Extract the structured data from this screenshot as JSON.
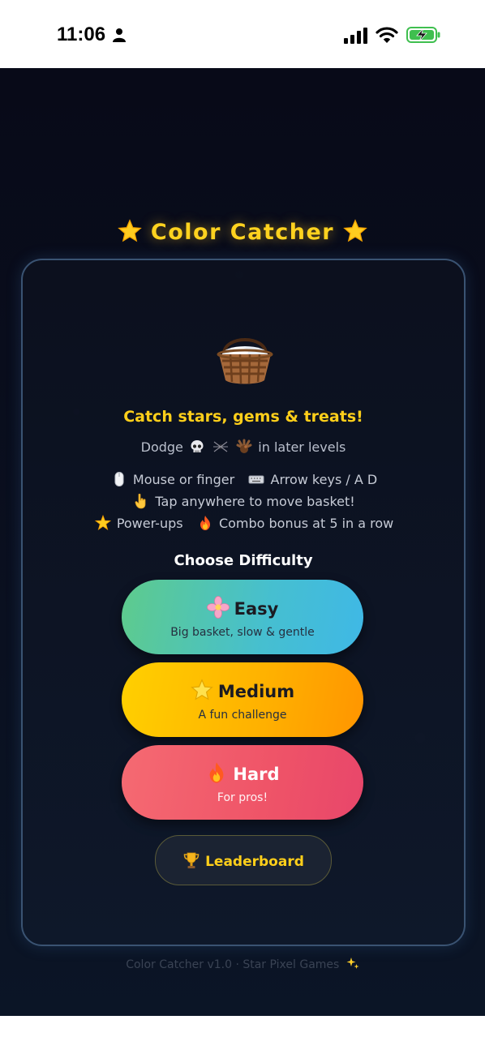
{
  "status_bar": {
    "time": "11:06",
    "icons": [
      "person-icon",
      "signal-icon",
      "wifi-icon",
      "battery-charging-icon"
    ]
  },
  "game": {
    "title": "Color Catcher",
    "tagline": "Catch stars, gems & treats!",
    "dodge_prefix": "Dodge",
    "dodge_suffix": "in later levels",
    "dodge_icons": [
      "skull-icon",
      "spider-icon",
      "turkey-icon"
    ],
    "controls": {
      "mouse": "Mouse or finger",
      "keys": "Arrow keys / A D",
      "tap": "Tap anywhere to move basket!",
      "powerups": "Power-ups",
      "combo": "Combo bonus at 5 in a row"
    },
    "choose_label": "Choose Difficulty",
    "difficulties": [
      {
        "label": "Easy",
        "desc": "Big basket, slow & gentle",
        "icon": "blossom-icon",
        "color_from": "#5ecb8c",
        "color_to": "#3fb8e6"
      },
      {
        "label": "Medium",
        "desc": "A fun challenge",
        "icon": "star-icon",
        "color_from": "#ffd000",
        "color_to": "#ff9500"
      },
      {
        "label": "Hard",
        "desc": "For pros!",
        "icon": "fire-icon",
        "color_from": "#f56a72",
        "color_to": "#e8466a"
      }
    ],
    "leaderboard_label": "Leaderboard",
    "footer": "Color Catcher v1.0 · Star Pixel Games"
  },
  "colors": {
    "accent_gold": "#ffcf1a",
    "panel_border": "#3a5372",
    "background": "#0a1020"
  }
}
